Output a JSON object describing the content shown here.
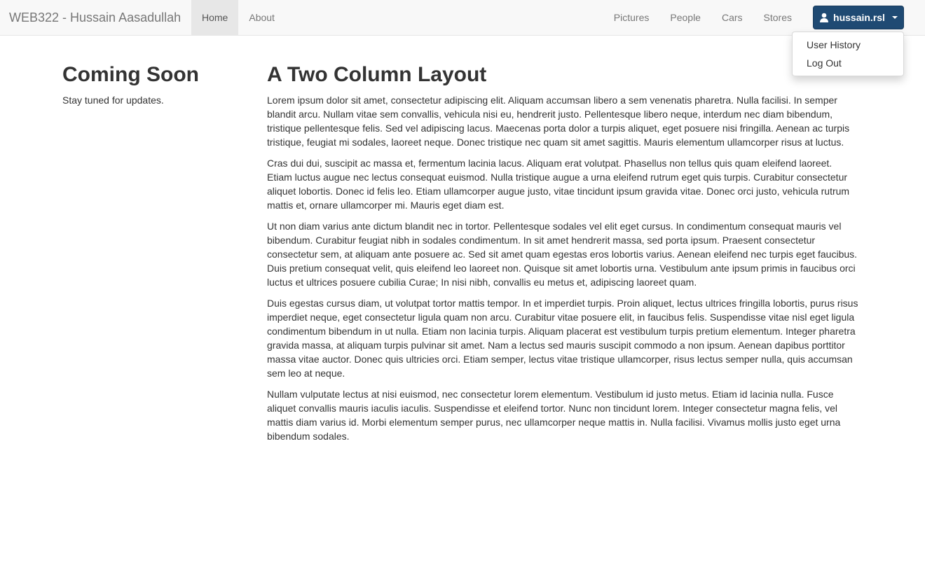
{
  "navbar": {
    "brand": "WEB322 - Hussain Aasadullah",
    "left": [
      "Home",
      "About"
    ],
    "right": [
      "Pictures",
      "People",
      "Cars",
      "Stores"
    ],
    "user": "hussain.rsl",
    "menu": [
      "User History",
      "Log Out"
    ]
  },
  "sidebar": {
    "title": "Coming Soon",
    "text": "Stay tuned for updates."
  },
  "main": {
    "title": "A Two Column Layout",
    "paragraphs": [
      "Lorem ipsum dolor sit amet, consectetur adipiscing elit. Aliquam accumsan libero a sem venenatis pharetra. Nulla facilisi. In semper blandit arcu. Nullam vitae sem convallis, vehicula nisi eu, hendrerit justo. Pellentesque libero neque, interdum nec diam bibendum, tristique pellentesque felis. Sed vel adipiscing lacus. Maecenas porta dolor a turpis aliquet, eget posuere nisi fringilla. Aenean ac turpis tristique, feugiat mi sodales, laoreet neque. Donec tristique nec quam sit amet sagittis. Mauris elementum ullamcorper risus at luctus.",
      "Cras dui dui, suscipit ac massa et, fermentum lacinia lacus. Aliquam erat volutpat. Phasellus non tellus quis quam eleifend laoreet. Etiam luctus augue nec lectus consequat euismod. Nulla tristique augue a urna eleifend rutrum eget quis turpis. Curabitur consectetur aliquet lobortis. Donec id felis leo. Etiam ullamcorper augue justo, vitae tincidunt ipsum gravida vitae. Donec orci justo, vehicula rutrum mattis et, ornare ullamcorper mi. Mauris eget diam est.",
      "Ut non diam varius ante dictum blandit nec in tortor. Pellentesque sodales vel elit eget cursus. In condimentum consequat mauris vel bibendum. Curabitur feugiat nibh in sodales condimentum. In sit amet hendrerit massa, sed porta ipsum. Praesent consectetur consectetur sem, at aliquam ante posuere ac. Sed sit amet quam egestas eros lobortis varius. Aenean eleifend nec turpis eget faucibus. Duis pretium consequat velit, quis eleifend leo laoreet non. Quisque sit amet lobortis urna. Vestibulum ante ipsum primis in faucibus orci luctus et ultrices posuere cubilia Curae; In nisi nibh, convallis eu metus et, adipiscing laoreet quam.",
      "Duis egestas cursus diam, ut volutpat tortor mattis tempor. In et imperdiet turpis. Proin aliquet, lectus ultrices fringilla lobortis, purus risus imperdiet neque, eget consectetur ligula quam non arcu. Curabitur vitae posuere elit, in faucibus felis. Suspendisse vitae nisl eget ligula condimentum bibendum in ut nulla. Etiam non lacinia turpis. Aliquam placerat est vestibulum turpis pretium elementum. Integer pharetra gravida massa, at aliquam turpis pulvinar sit amet. Nam a lectus sed mauris suscipit commodo a non ipsum. Aenean dapibus porttitor massa vitae auctor. Donec quis ultricies orci. Etiam semper, lectus vitae tristique ullamcorper, risus lectus semper nulla, quis accumsan sem leo at neque.",
      "Nullam vulputate lectus at nisi euismod, nec consectetur lorem elementum. Vestibulum id justo metus. Etiam id lacinia nulla. Fusce aliquet convallis mauris iaculis iaculis. Suspendisse et eleifend tortor. Nunc non tincidunt lorem. Integer consectetur magna felis, vel mattis diam varius id. Morbi elementum semper purus, nec ullamcorper neque mattis in. Nulla facilisi. Vivamus mollis justo eget urna bibendum sodales."
    ]
  }
}
